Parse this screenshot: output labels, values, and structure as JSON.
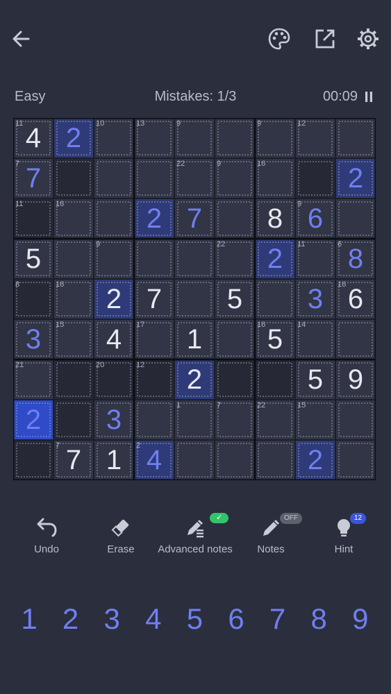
{
  "header": {
    "back_icon": "arrow-left-icon",
    "theme_icon": "palette-icon",
    "share_icon": "external-link-icon",
    "settings_icon": "gear-icon"
  },
  "status": {
    "difficulty": "Easy",
    "mistakes": "Mistakes: 1/3",
    "timer": "00:09",
    "pause_icon": "pause-icon"
  },
  "colors": {
    "background": "#2b2e3c",
    "cell_dark": "#262835",
    "cell_normal": "#323545",
    "highlight": "#2f3b78",
    "selected": "#2f4bc7",
    "given_digit": "#e8e9ee",
    "user_digit": "#6f7ff2",
    "cage_line": "#b6bdd4",
    "accent_green": "#31c46b"
  },
  "board": {
    "values": [
      [
        "4",
        "2",
        "",
        "",
        "",
        "",
        "",
        "",
        ""
      ],
      [
        "7",
        "",
        "",
        "",
        "",
        "",
        "",
        "",
        "2"
      ],
      [
        "",
        "",
        "",
        "2",
        "7",
        "",
        "8",
        "6",
        ""
      ],
      [
        "5",
        "",
        "",
        "",
        "",
        "",
        "2",
        "",
        "8"
      ],
      [
        "",
        "",
        "2",
        "7",
        "",
        "5",
        "",
        "3",
        "6"
      ],
      [
        "3",
        "",
        "4",
        "",
        "1",
        "",
        "5",
        "",
        ""
      ],
      [
        "",
        "",
        "",
        "",
        "2",
        "",
        "",
        "5",
        "9"
      ],
      [
        "2",
        "",
        "3",
        "",
        "",
        "",
        "",
        "",
        ""
      ],
      [
        "",
        "7",
        "1",
        "4",
        "",
        "",
        "",
        "2",
        ""
      ]
    ],
    "given": [
      [
        1,
        0,
        0,
        0,
        0,
        0,
        0,
        0,
        0
      ],
      [
        0,
        0,
        0,
        0,
        0,
        0,
        0,
        0,
        0
      ],
      [
        0,
        0,
        0,
        0,
        0,
        0,
        1,
        0,
        0
      ],
      [
        1,
        0,
        0,
        0,
        0,
        0,
        0,
        0,
        0
      ],
      [
        0,
        0,
        1,
        1,
        0,
        1,
        0,
        0,
        1
      ],
      [
        0,
        0,
        1,
        0,
        1,
        0,
        1,
        0,
        0
      ],
      [
        0,
        0,
        0,
        0,
        1,
        0,
        0,
        1,
        1
      ],
      [
        0,
        0,
        0,
        0,
        0,
        0,
        0,
        0,
        0
      ],
      [
        0,
        1,
        1,
        0,
        0,
        0,
        0,
        0,
        0
      ]
    ],
    "cage_sums": [
      {
        "r": 0,
        "c": 0,
        "sum": "11"
      },
      {
        "r": 0,
        "c": 2,
        "sum": "10"
      },
      {
        "r": 0,
        "c": 3,
        "sum": "13"
      },
      {
        "r": 0,
        "c": 4,
        "sum": "9"
      },
      {
        "r": 0,
        "c": 6,
        "sum": "9"
      },
      {
        "r": 0,
        "c": 7,
        "sum": "12"
      },
      {
        "r": 1,
        "c": 0,
        "sum": "7"
      },
      {
        "r": 1,
        "c": 4,
        "sum": "22"
      },
      {
        "r": 1,
        "c": 5,
        "sum": "9"
      },
      {
        "r": 1,
        "c": 6,
        "sum": "16"
      },
      {
        "r": 2,
        "c": 0,
        "sum": "11"
      },
      {
        "r": 2,
        "c": 1,
        "sum": "16"
      },
      {
        "r": 2,
        "c": 7,
        "sum": "9"
      },
      {
        "r": 3,
        "c": 2,
        "sum": "9"
      },
      {
        "r": 3,
        "c": 5,
        "sum": "22"
      },
      {
        "r": 3,
        "c": 7,
        "sum": "11"
      },
      {
        "r": 3,
        "c": 8,
        "sum": "6"
      },
      {
        "r": 4,
        "c": 0,
        "sum": "8"
      },
      {
        "r": 4,
        "c": 1,
        "sum": "16"
      },
      {
        "r": 4,
        "c": 8,
        "sum": "16"
      },
      {
        "r": 5,
        "c": 1,
        "sum": "15"
      },
      {
        "r": 5,
        "c": 3,
        "sum": "17"
      },
      {
        "r": 5,
        "c": 6,
        "sum": "16"
      },
      {
        "r": 5,
        "c": 7,
        "sum": "14"
      },
      {
        "r": 6,
        "c": 0,
        "sum": "21"
      },
      {
        "r": 6,
        "c": 2,
        "sum": "20"
      },
      {
        "r": 6,
        "c": 3,
        "sum": "12"
      },
      {
        "r": 7,
        "c": 4,
        "sum": "1"
      },
      {
        "r": 7,
        "c": 5,
        "sum": "7"
      },
      {
        "r": 7,
        "c": 6,
        "sum": "22"
      },
      {
        "r": 7,
        "c": 7,
        "sum": "15"
      },
      {
        "r": 8,
        "c": 1,
        "sum": "7"
      },
      {
        "r": 8,
        "c": 3,
        "sum": "2"
      }
    ],
    "highlighted": [
      [
        0,
        1
      ],
      [
        1,
        8
      ],
      [
        2,
        3
      ],
      [
        3,
        6
      ],
      [
        4,
        2
      ],
      [
        6,
        4
      ],
      [
        8,
        7
      ],
      [
        8,
        3
      ]
    ],
    "selected": [
      7,
      0
    ]
  },
  "toolbar": {
    "undo_label": "Undo",
    "erase_label": "Erase",
    "advanced_label": "Advanced notes",
    "advanced_badge": "✓",
    "notes_label": "Notes",
    "notes_badge": "OFF",
    "hint_label": "Hint",
    "hint_badge": "12",
    "undo_icon": "undo-icon",
    "erase_icon": "eraser-icon",
    "advanced_icon": "pencil-list-icon",
    "notes_icon": "pencil-icon",
    "hint_icon": "lightbulb-icon"
  },
  "numpad": [
    "1",
    "2",
    "3",
    "4",
    "5",
    "6",
    "7",
    "8",
    "9"
  ]
}
